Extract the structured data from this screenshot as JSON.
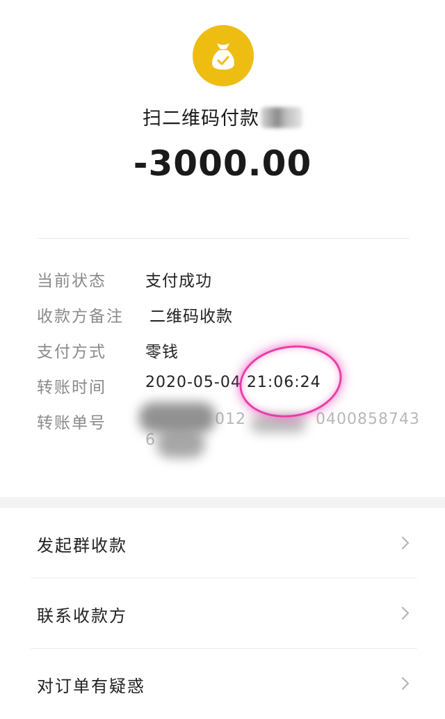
{
  "header": {
    "title": "扫二维码付款",
    "amount": "-3000.00"
  },
  "details": [
    {
      "label": "当前状态",
      "value": "支付成功"
    },
    {
      "label": "收款方备注",
      "value": "二维码收款"
    },
    {
      "label": "支付方式",
      "value": "零钱"
    },
    {
      "label": "转账时间",
      "value": "2020-05-04 21:06:24"
    },
    {
      "label": "转账单号",
      "value_visible_part1": "012",
      "value_visible_part2": "0400858743",
      "value_visible_line2": "6"
    }
  ],
  "menu": [
    {
      "label": "发起群收款"
    },
    {
      "label": "联系收款方"
    },
    {
      "label": "对订单有疑惑"
    }
  ],
  "colors": {
    "icon_bg": "#eebd12",
    "annotation_circle": "#e43fa9"
  },
  "icons": {
    "merchant": "money-bag-check-icon",
    "chevron": "chevron-right-icon"
  }
}
